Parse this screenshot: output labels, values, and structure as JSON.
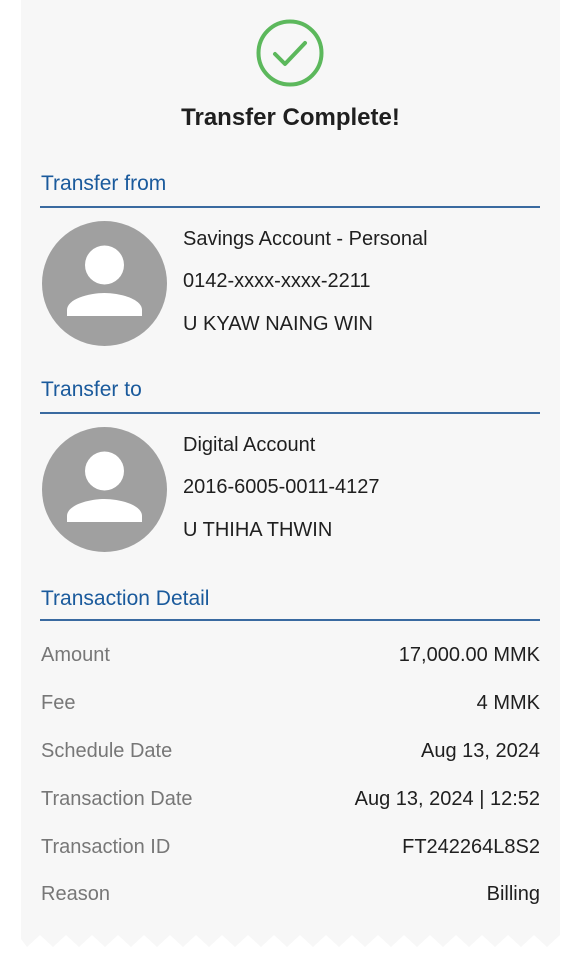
{
  "header": {
    "title": "Transfer Complete!",
    "status_icon": "check-circle-icon",
    "status_color": "#5cb85c"
  },
  "transfer_from": {
    "label": "Transfer from",
    "account_type": "Savings Account - Personal",
    "account_number": "0142-xxxx-xxxx-2211",
    "name": "U KYAW NAING WIN"
  },
  "transfer_to": {
    "label": "Transfer to",
    "account_type": "Digital Account",
    "account_number": "2016-6005-0011-4127",
    "name": "U THIHA THWIN"
  },
  "transaction_detail": {
    "label": "Transaction Detail",
    "rows": [
      {
        "label": "Amount",
        "value": "17,000.00 MMK"
      },
      {
        "label": "Fee",
        "value": "4 MMK"
      },
      {
        "label": "Schedule Date",
        "value": "Aug 13, 2024"
      },
      {
        "label": "Transaction Date",
        "value": "Aug 13, 2024 | 12:52"
      },
      {
        "label": "Transaction ID",
        "value": "FT242264L8S2"
      },
      {
        "label": "Reason",
        "value": "Billing"
      }
    ]
  },
  "colors": {
    "accent": "#1a5a9c",
    "avatar_bg": "#a0a0a0"
  }
}
